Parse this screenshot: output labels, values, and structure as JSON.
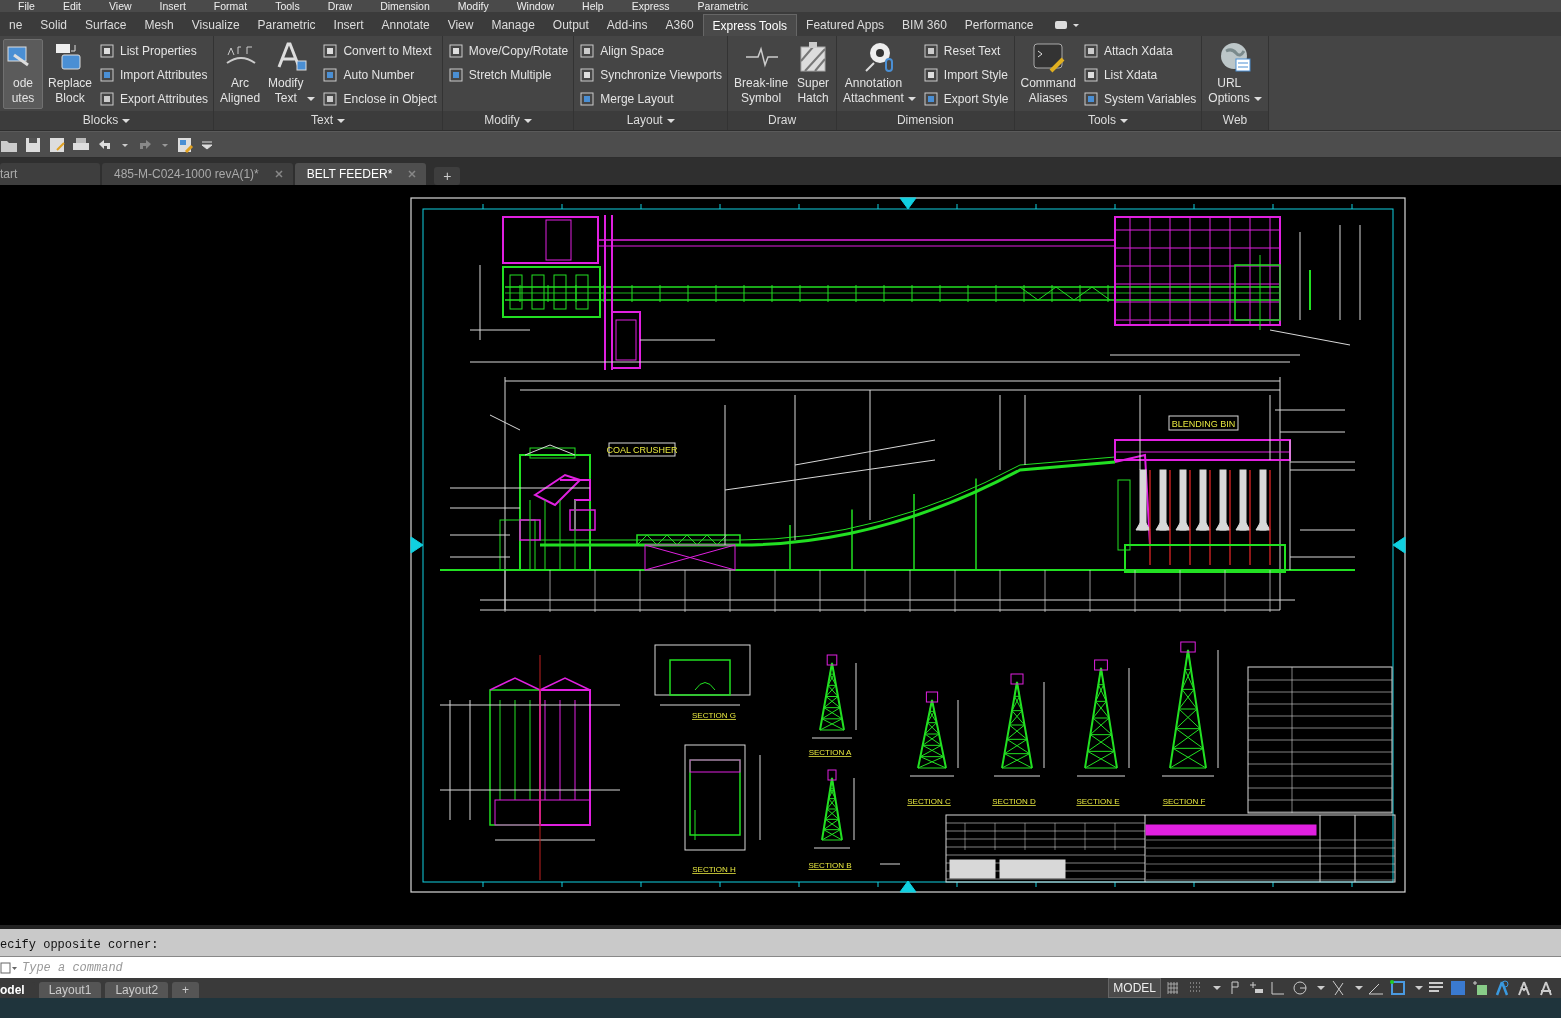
{
  "menu_bar": [
    "File",
    "Edit",
    "View",
    "Insert",
    "Format",
    "Tools",
    "Draw",
    "Dimension",
    "Modify",
    "Window",
    "Help",
    "Express",
    "Parametric"
  ],
  "ribbon_tabs": [
    {
      "label": "ne",
      "selected": false
    },
    {
      "label": "Solid",
      "selected": false
    },
    {
      "label": "Surface",
      "selected": false
    },
    {
      "label": "Mesh",
      "selected": false
    },
    {
      "label": "Visualize",
      "selected": false
    },
    {
      "label": "Parametric",
      "selected": false
    },
    {
      "label": "Insert",
      "selected": false
    },
    {
      "label": "Annotate",
      "selected": false
    },
    {
      "label": "View",
      "selected": false
    },
    {
      "label": "Manage",
      "selected": false
    },
    {
      "label": "Output",
      "selected": false
    },
    {
      "label": "Add-ins",
      "selected": false
    },
    {
      "label": "A360",
      "selected": false
    },
    {
      "label": "Express Tools",
      "selected": true
    },
    {
      "label": "Featured Apps",
      "selected": false
    },
    {
      "label": "BIM 360",
      "selected": false
    },
    {
      "label": "Performance",
      "selected": false
    }
  ],
  "ribbon_panels": [
    {
      "title": "Blocks",
      "menu": true,
      "items": [
        {
          "kind": "large",
          "label": "ode utes",
          "highlighted": true,
          "dropdown": false
        },
        {
          "kind": "large",
          "label": "Replace Block",
          "highlighted": false,
          "dropdown": false
        },
        {
          "kind": "stack",
          "labels": [
            "List Properties",
            "Import Attributes",
            "Export Attributes"
          ]
        }
      ]
    },
    {
      "title": "Text",
      "menu": true,
      "items": [
        {
          "kind": "large",
          "label": "Arc Aligned",
          "highlighted": false,
          "dropdown": false
        },
        {
          "kind": "large",
          "label": "Modify Text",
          "highlighted": false,
          "dropdown": true
        },
        {
          "kind": "stack",
          "labels": [
            "Convert to Mtext",
            "Auto Number",
            "Enclose in Object"
          ]
        }
      ]
    },
    {
      "title": "Modify",
      "menu": true,
      "items": [
        {
          "kind": "stack",
          "labels": [
            "Move/Copy/Rotate",
            "Stretch Multiple"
          ]
        }
      ]
    },
    {
      "title": "Layout",
      "menu": true,
      "items": [
        {
          "kind": "stack",
          "labels": [
            "Align Space",
            "Synchronize Viewports",
            "Merge Layout"
          ]
        }
      ]
    },
    {
      "title": "Draw",
      "menu": false,
      "items": [
        {
          "kind": "large",
          "label": "Break-line Symbol",
          "highlighted": false,
          "dropdown": false
        },
        {
          "kind": "large",
          "label": "Super Hatch",
          "highlighted": false,
          "dropdown": false
        }
      ]
    },
    {
      "title": "Dimension",
      "menu": false,
      "items": [
        {
          "kind": "large",
          "label": "Annotation Attachment",
          "highlighted": false,
          "dropdown": true
        },
        {
          "kind": "stack",
          "labels": [
            "Reset Text",
            "Import Style",
            "Export Style"
          ]
        }
      ]
    },
    {
      "title": "Tools",
      "menu": true,
      "items": [
        {
          "kind": "large",
          "label": "Command Aliases",
          "highlighted": false,
          "dropdown": false
        },
        {
          "kind": "stack",
          "labels": [
            "Attach Xdata",
            "List Xdata",
            "System Variables"
          ]
        }
      ]
    },
    {
      "title": "Web",
      "menu": false,
      "items": [
        {
          "kind": "large",
          "label": "URL Options",
          "highlighted": false,
          "dropdown": true
        }
      ]
    }
  ],
  "file_tabs": [
    {
      "label": "tart",
      "selected": false,
      "closable": false
    },
    {
      "label": "485-M-C024-1000 revA(1)*",
      "selected": false,
      "closable": true
    },
    {
      "label": "BELT FEEDER*",
      "selected": true,
      "closable": true
    }
  ],
  "new_tab": "+",
  "drawing": {
    "boxed_labels": [
      "COAL CRUSHER",
      "BLENDING BIN"
    ],
    "section_labels": [
      "SECTION G",
      "SECTION A",
      "SECTION C",
      "SECTION D",
      "SECTION E",
      "SECTION F",
      "SECTION H",
      "SECTION B"
    ]
  },
  "command_line": {
    "history": "ecify opposite corner:",
    "placeholder": "Type a command"
  },
  "layout_tabs": [
    {
      "label": "odel",
      "selected": true
    },
    {
      "label": "Layout1",
      "selected": false
    },
    {
      "label": "Layout2",
      "selected": false
    }
  ],
  "new_layout": "+",
  "status_bar": {
    "space": "MODEL"
  }
}
